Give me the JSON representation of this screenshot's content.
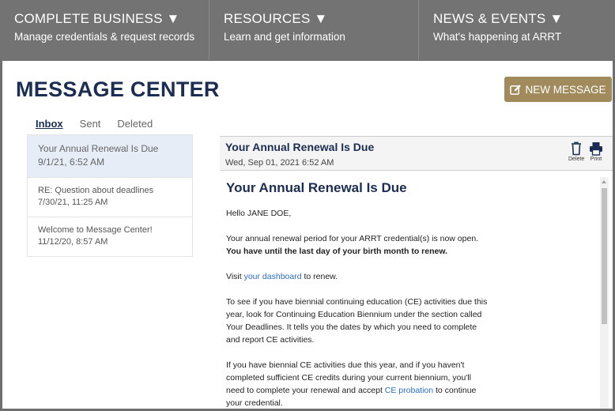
{
  "topnav": [
    {
      "title": "COMPLETE BUSINESS ▼",
      "subtitle": "Manage credentials & request records"
    },
    {
      "title": "RESOURCES ▼",
      "subtitle": "Learn and get information"
    },
    {
      "title": "NEWS & EVENTS ▼",
      "subtitle": "What's happening at ARRT"
    }
  ],
  "page": {
    "title": "MESSAGE CENTER",
    "new_message_label": "NEW MESSAGE",
    "new_message_icon": "edit-icon"
  },
  "tabs": [
    "Inbox",
    "Sent",
    "Deleted"
  ],
  "messages": [
    {
      "subject": "Your Annual Renewal Is Due",
      "date": "9/1/21, 6:52 AM"
    },
    {
      "subject": "RE: Question about deadlines",
      "date": "7/30/21, 11:25 AM"
    },
    {
      "subject": "Welcome to Message Center!",
      "date": "11/12/20, 8:57 AM"
    }
  ],
  "detail": {
    "subject": "Your Annual Renewal Is Due",
    "date": "Wed, Sep 01, 2021 6:52 AM",
    "delete_label": "Delete",
    "print_label": "Print",
    "body": {
      "title": "Your Annual Renewal Is Due",
      "greeting": "Hello JANE DOE,",
      "p1": "Your annual renewal period for your ARRT credential(s) is now open.",
      "p1_bold": "You have until the last day of your birth month to renew.",
      "p2_pre": "Visit ",
      "p2_link": "your dashboard",
      "p2_post": " to renew.",
      "p3": "To see if you have biennial continuing education (CE) activities due this year, look for Continuing Education Biennium under the section called Your Deadlines. It tells you the dates by which you need to complete and report CE activities.",
      "p4_pre": "If you have biennial CE activities due this year, and if you haven't completed sufficient CE credits during your current biennium, you'll need to complete your renewal and accept ",
      "p4_link": "CE probation",
      "p4_post": " to continue your credential."
    }
  },
  "colors": {
    "navy": "#1b2d52",
    "gold": "#a18b5c",
    "link": "#2b6cc4",
    "nav_bg": "#737373",
    "selected_bg": "#e6edf7"
  }
}
